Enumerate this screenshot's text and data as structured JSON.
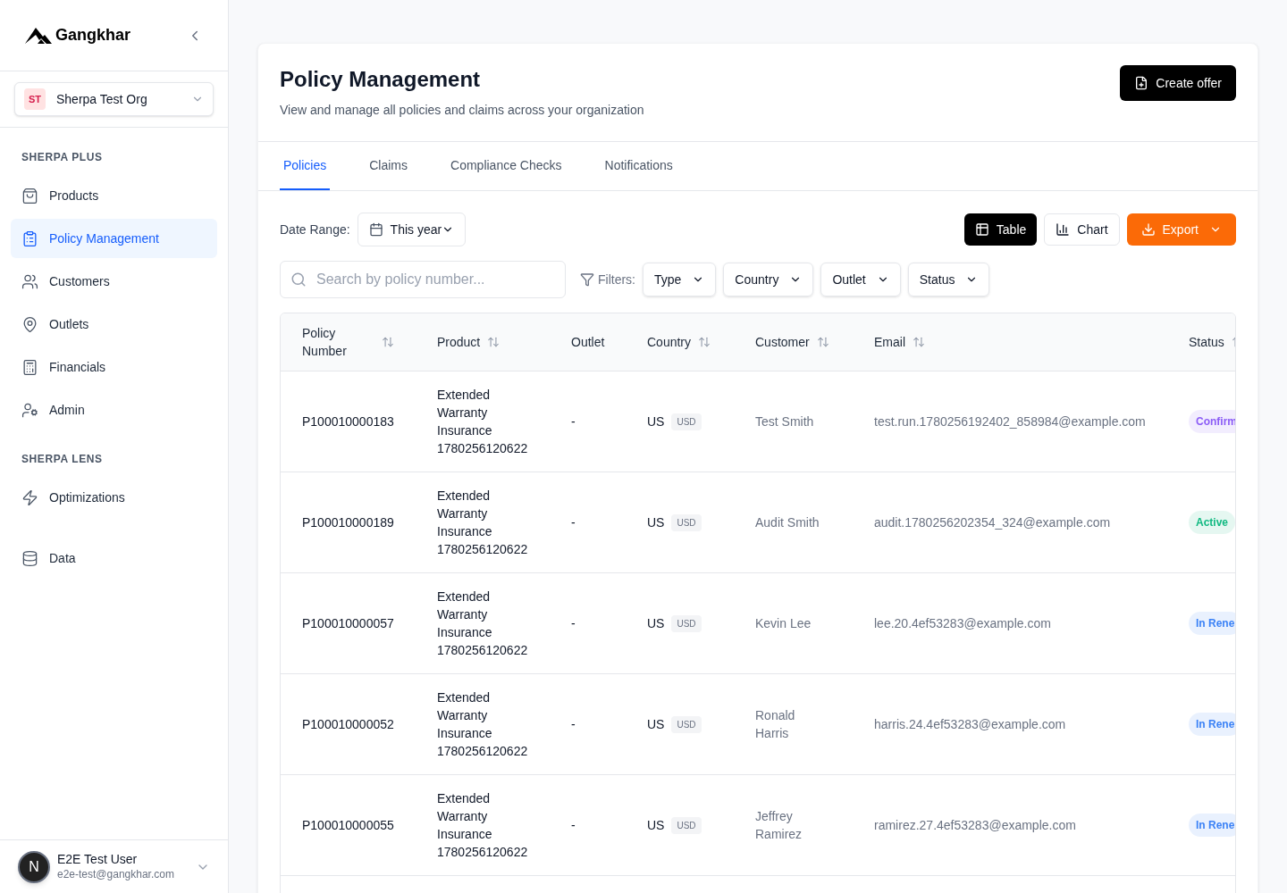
{
  "sidebar": {
    "brand": "Gangkhar",
    "org": {
      "initials": "ST",
      "name": "Sherpa Test Org"
    },
    "sections": [
      {
        "title": "SHERPA PLUS",
        "items": [
          {
            "label": "Products",
            "selected": false
          },
          {
            "label": "Policy Management",
            "selected": true
          },
          {
            "label": "Customers",
            "selected": false
          },
          {
            "label": "Outlets",
            "selected": false
          },
          {
            "label": "Financials",
            "selected": false
          },
          {
            "label": "Admin",
            "selected": false
          }
        ]
      },
      {
        "title": "SHERPA LENS",
        "items": [
          {
            "label": "Optimizations",
            "selected": false
          }
        ]
      },
      {
        "items": [
          {
            "label": "Data",
            "selected": false
          }
        ]
      }
    ],
    "user": {
      "initial": "N",
      "name": "E2E Test User",
      "email": "e2e-test@gangkhar.com"
    }
  },
  "header": {
    "title": "Policy Management",
    "subtitle": "View and manage all policies and claims across your organization",
    "action": "Create offer"
  },
  "tabs": [
    {
      "label": "Policies",
      "selected": true
    },
    {
      "label": "Claims",
      "selected": false
    },
    {
      "label": "Compliance Checks",
      "selected": false
    },
    {
      "label": "Notifications",
      "selected": false
    }
  ],
  "toolbar": {
    "date_label": "Date Range:",
    "date_value": "This year",
    "views": [
      {
        "label": "Table",
        "selected": true
      },
      {
        "label": "Chart",
        "selected": false
      }
    ],
    "export": "Export"
  },
  "search": {
    "placeholder": "Search by policy number..."
  },
  "filters": {
    "label": "Filters:",
    "items": [
      "Type",
      "Country",
      "Outlet",
      "Status"
    ]
  },
  "table": {
    "columns": [
      {
        "label": "Policy Number",
        "sortable": true
      },
      {
        "label": "Product",
        "sortable": true
      },
      {
        "label": "Outlet",
        "sortable": false
      },
      {
        "label": "Country",
        "sortable": true
      },
      {
        "label": "Customer",
        "sortable": true
      },
      {
        "label": "Email",
        "sortable": true
      },
      {
        "label": "Status",
        "sortable": true
      }
    ],
    "rows": [
      {
        "policy": "P100010000183",
        "product": "Extended Warranty Insurance 1780256120622",
        "outlet": "-",
        "country": "US",
        "currency": "USD",
        "customer": "Test Smith",
        "email": "test.run.1780256192402_858984@example.com",
        "status": {
          "label": "Confirm",
          "color": "#8b5cf6"
        }
      },
      {
        "policy": "P100010000189",
        "product": "Extended Warranty Insurance 1780256120622",
        "outlet": "-",
        "country": "US",
        "currency": "USD",
        "customer": "Audit Smith",
        "email": "audit.1780256202354_324@example.com",
        "status": {
          "label": "Active",
          "color": "#10b981"
        }
      },
      {
        "policy": "P100010000057",
        "product": "Extended Warranty Insurance 1780256120622",
        "outlet": "-",
        "country": "US",
        "currency": "USD",
        "customer": "Kevin Lee",
        "email": "lee.20.4ef53283@example.com",
        "status": {
          "label": "In Rene",
          "color": "#3b82f6"
        }
      },
      {
        "policy": "P100010000052",
        "product": "Extended Warranty Insurance 1780256120622",
        "outlet": "-",
        "country": "US",
        "currency": "USD",
        "customer": "Ronald Harris",
        "email": "harris.24.4ef53283@example.com",
        "status": {
          "label": "In Rene",
          "color": "#3b82f6"
        }
      },
      {
        "policy": "P100010000055",
        "product": "Extended Warranty Insurance 1780256120622",
        "outlet": "-",
        "country": "US",
        "currency": "USD",
        "customer": "Jeffrey Ramirez",
        "email": "ramirez.27.4ef53283@example.com",
        "status": {
          "label": "In Rene",
          "color": "#3b82f6"
        }
      }
    ]
  }
}
